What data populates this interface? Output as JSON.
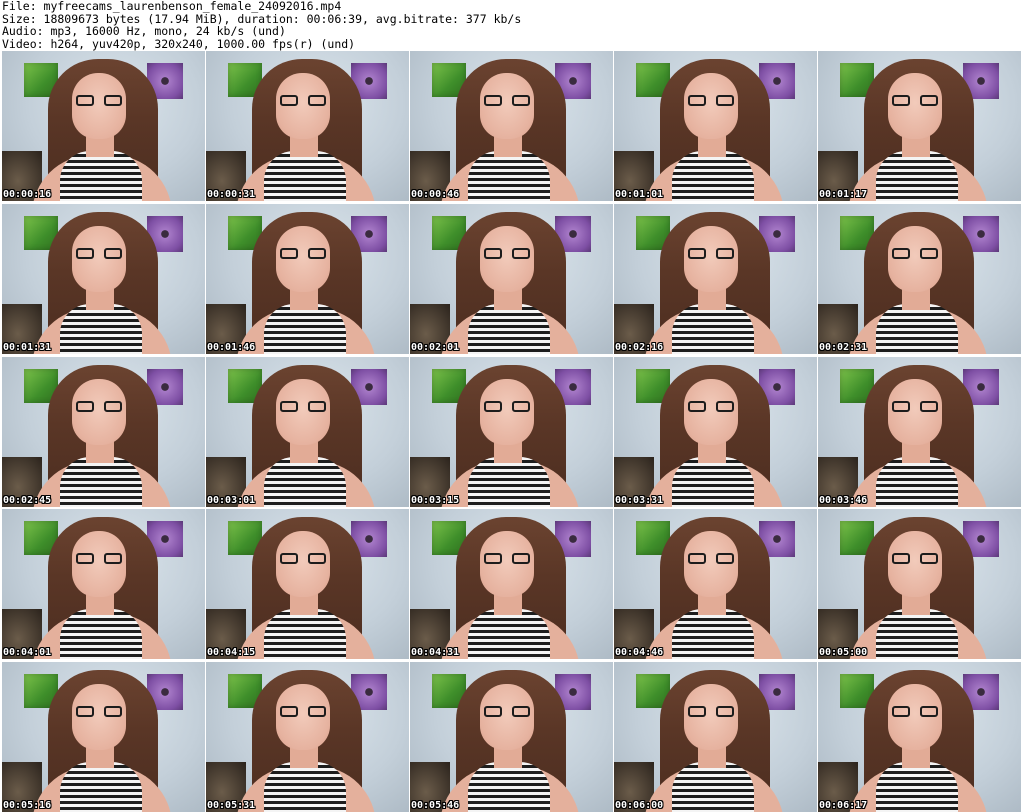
{
  "header": {
    "file_line": "File: myfreecams_laurenbenson_female_24092016.mp4",
    "size_line": "Size: 18809673 bytes (17.94 MiB), duration: 00:06:39, avg.bitrate: 377 kb/s",
    "audio_line": "Audio: mp3, 16000 Hz, mono, 24 kb/s (und)",
    "video_line": "Video: h264, yuv420p, 320x240, 1000.00 fps(r) (und)"
  },
  "thumbnails": [
    {
      "timestamp": "00:00:16"
    },
    {
      "timestamp": "00:00:31"
    },
    {
      "timestamp": "00:00:46"
    },
    {
      "timestamp": "00:01:01"
    },
    {
      "timestamp": "00:01:17"
    },
    {
      "timestamp": "00:01:31"
    },
    {
      "timestamp": "00:01:46"
    },
    {
      "timestamp": "00:02:01"
    },
    {
      "timestamp": "00:02:16"
    },
    {
      "timestamp": "00:02:31"
    },
    {
      "timestamp": "00:02:45"
    },
    {
      "timestamp": "00:03:01"
    },
    {
      "timestamp": "00:03:15"
    },
    {
      "timestamp": "00:03:31"
    },
    {
      "timestamp": "00:03:46"
    },
    {
      "timestamp": "00:04:01"
    },
    {
      "timestamp": "00:04:15"
    },
    {
      "timestamp": "00:04:31"
    },
    {
      "timestamp": "00:04:46"
    },
    {
      "timestamp": "00:05:00"
    },
    {
      "timestamp": "00:05:16"
    },
    {
      "timestamp": "00:05:31"
    },
    {
      "timestamp": "00:05:46"
    },
    {
      "timestamp": "00:06:00"
    },
    {
      "timestamp": "00:06:17"
    }
  ]
}
